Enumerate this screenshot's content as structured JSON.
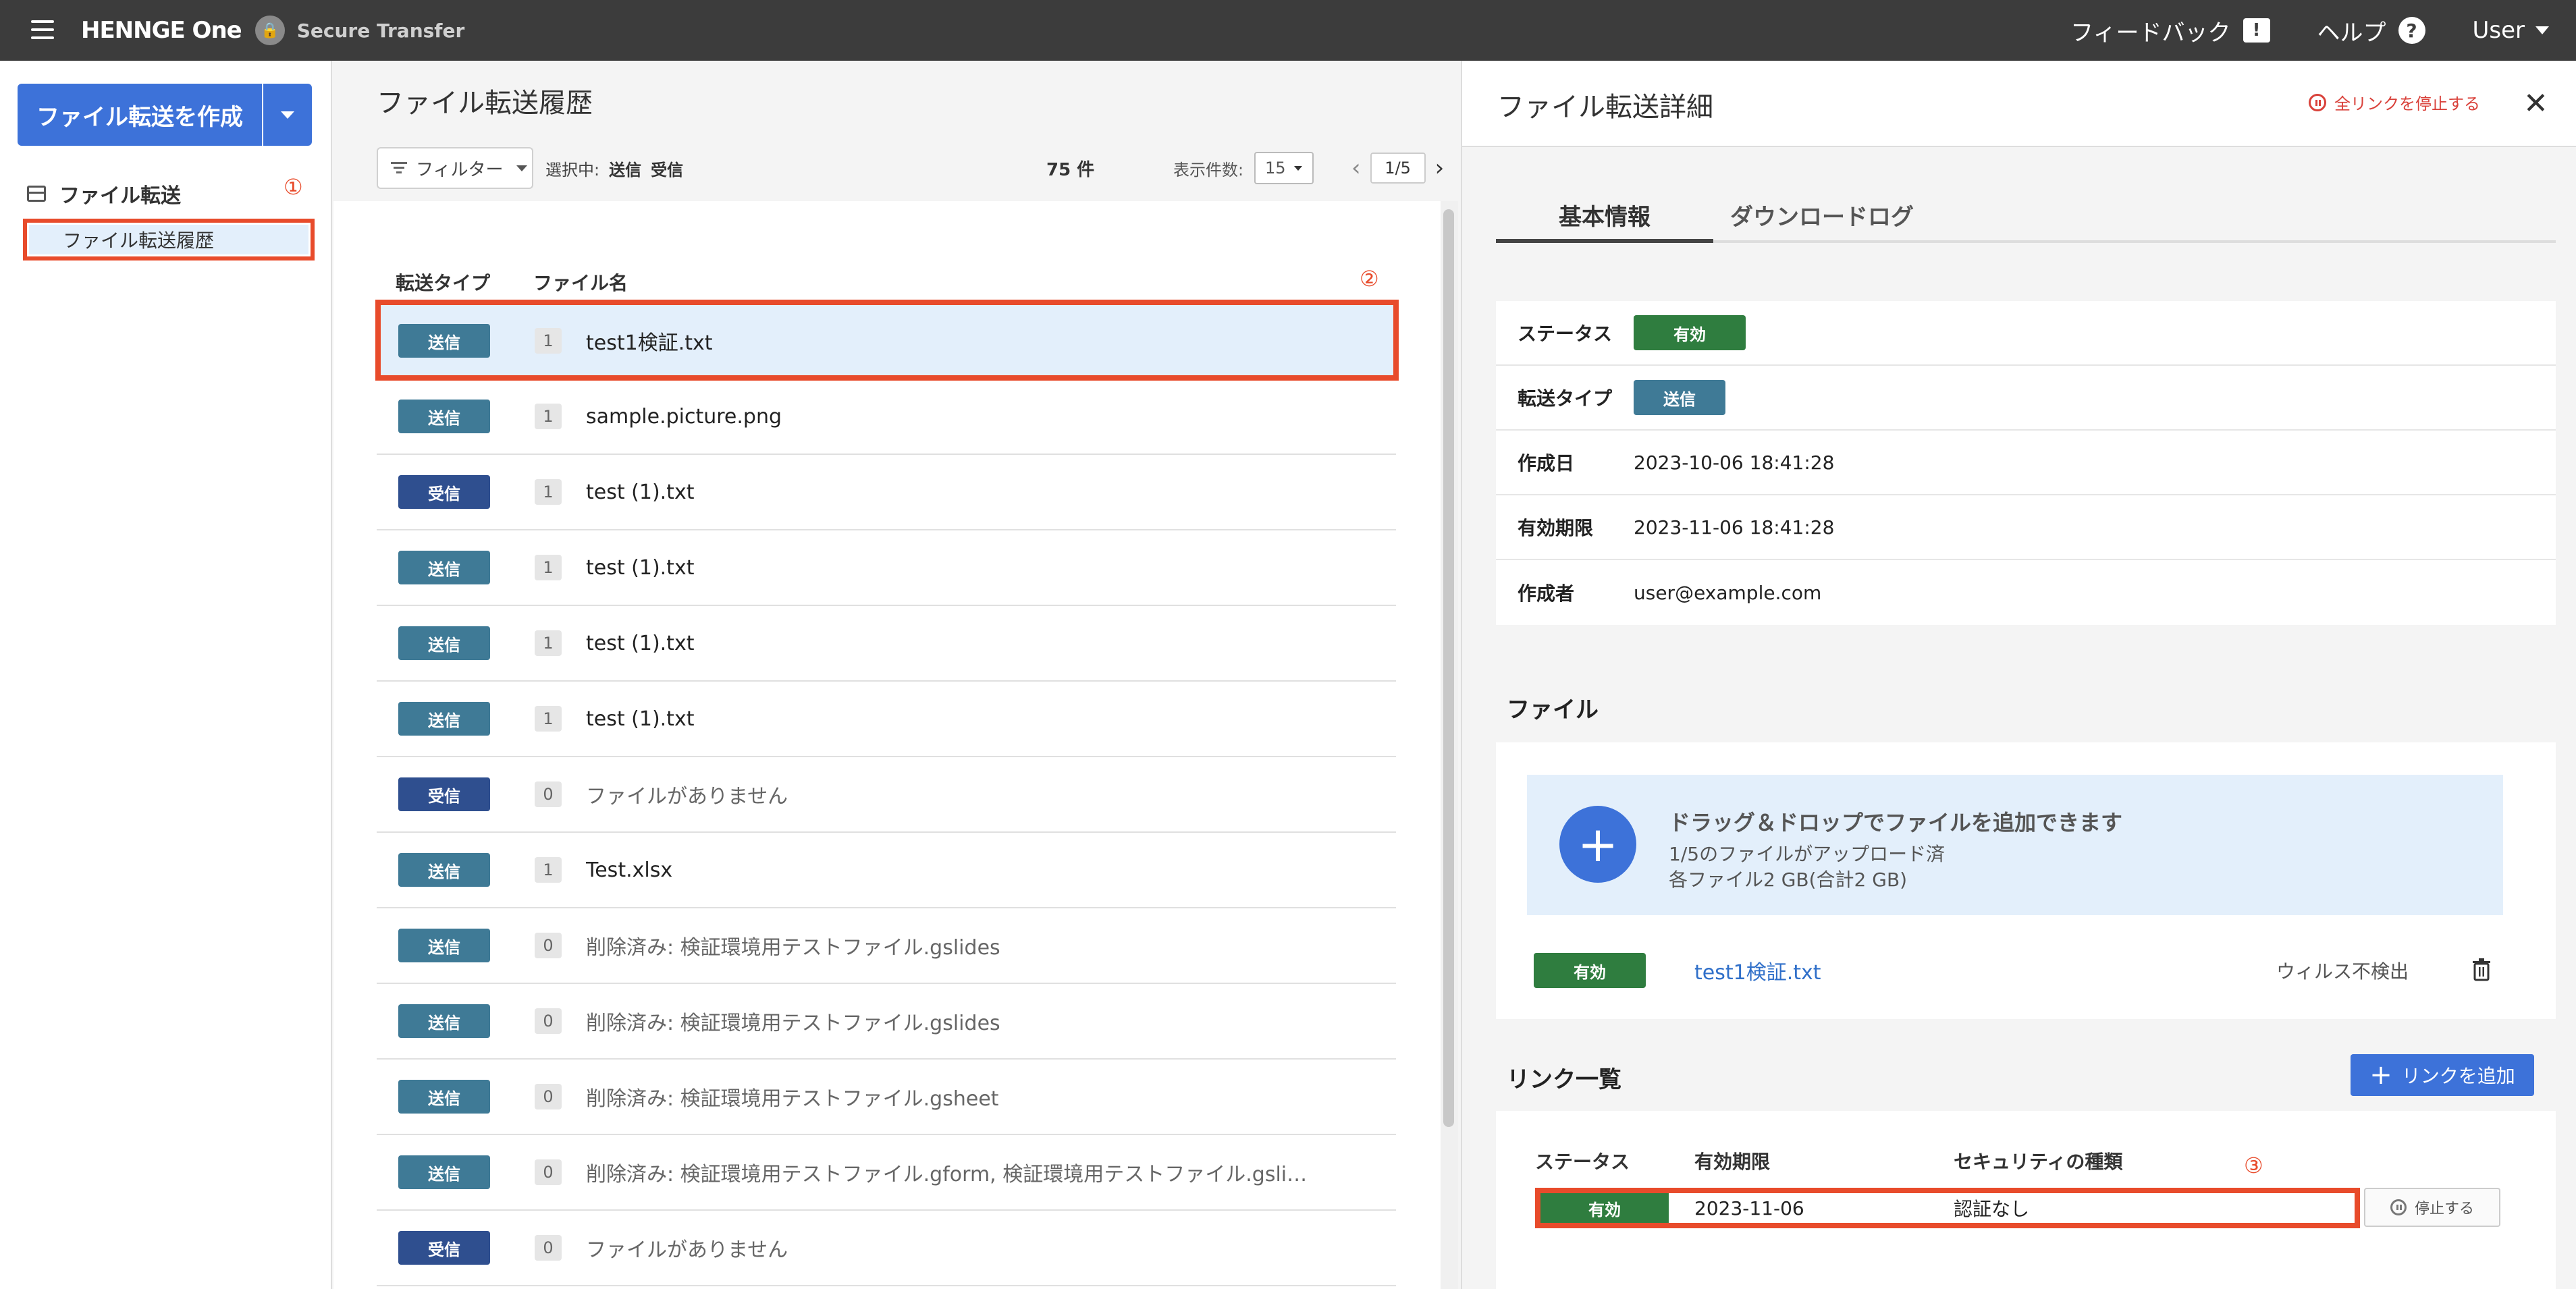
{
  "topbar": {
    "brand": "HENNGE One",
    "product": "Secure Transfer",
    "feedback": "フィードバック",
    "help": "ヘルプ",
    "user": "User"
  },
  "sidebar": {
    "create_label": "ファイル転送を作成",
    "section_label": "ファイル転送",
    "marker": "①",
    "item_history": "ファイル転送履歴"
  },
  "middle": {
    "title": "ファイル転送履歴",
    "filter_label": "フィルター",
    "selected_label": "選択中:",
    "selected_tags": [
      "送信",
      "受信"
    ],
    "count": "75 件",
    "per_page_label": "表示件数:",
    "per_page_value": "15",
    "page": "1/5",
    "col_type": "転送タイプ",
    "col_name": "ファイル名",
    "marker": "②",
    "rows": [
      {
        "type": "送信",
        "kind": "send",
        "count": "1",
        "name": "test1検証.txt",
        "muted": false
      },
      {
        "type": "送信",
        "kind": "send",
        "count": "1",
        "name": "sample.picture.png",
        "muted": false
      },
      {
        "type": "受信",
        "kind": "recv",
        "count": "1",
        "name": "test (1).txt",
        "muted": false
      },
      {
        "type": "送信",
        "kind": "send",
        "count": "1",
        "name": "test (1).txt",
        "muted": false
      },
      {
        "type": "送信",
        "kind": "send",
        "count": "1",
        "name": "test (1).txt",
        "muted": false
      },
      {
        "type": "送信",
        "kind": "send",
        "count": "1",
        "name": "test (1).txt",
        "muted": false
      },
      {
        "type": "受信",
        "kind": "recv",
        "count": "0",
        "name": "ファイルがありません",
        "muted": true
      },
      {
        "type": "送信",
        "kind": "send",
        "count": "1",
        "name": "Test.xlsx",
        "muted": false
      },
      {
        "type": "送信",
        "kind": "send",
        "count": "0",
        "name": "削除済み: 検証環境用テストファイル.gslides",
        "muted": true
      },
      {
        "type": "送信",
        "kind": "send",
        "count": "0",
        "name": "削除済み: 検証環境用テストファイル.gslides",
        "muted": true
      },
      {
        "type": "送信",
        "kind": "send",
        "count": "0",
        "name": "削除済み: 検証環境用テストファイル.gsheet",
        "muted": true
      },
      {
        "type": "送信",
        "kind": "send",
        "count": "0",
        "name": "削除済み: 検証環境用テストファイル.gform, 検証環境用テストファイル.gslides, 検...",
        "muted": true
      },
      {
        "type": "受信",
        "kind": "recv",
        "count": "0",
        "name": "ファイルがありません",
        "muted": true
      }
    ]
  },
  "detail": {
    "title": "ファイル転送詳細",
    "stop_all": "全リンクを停止する",
    "tab_basic": "基本情報",
    "tab_log": "ダウンロードログ",
    "info": {
      "status_key": "ステータス",
      "status_val": "有効",
      "type_key": "転送タイプ",
      "type_val": "送信",
      "created_key": "作成日",
      "created_val": "2023-10-06 18:41:28",
      "expiry_key": "有効期限",
      "expiry_val": "2023-11-06 18:41:28",
      "author_key": "作成者",
      "author_val": "user@example.com"
    },
    "files_title": "ファイル",
    "dropzone_title": "ドラッグ＆ドロップでファイルを追加できます",
    "dropzone_line1": "1/5のファイルがアップロード済",
    "dropzone_line2": "各ファイル2 GB(合計2 GB)",
    "file_status": "有効",
    "file_name": "test1検証.txt",
    "file_virus": "ウィルス不検出",
    "links_title": "リンク一覧",
    "add_link": "リンクを追加",
    "link_col_status": "ステータス",
    "link_col_expiry": "有効期限",
    "link_col_security": "セキュリティの種類",
    "marker": "③",
    "link_status": "有効",
    "link_expiry": "2023-11-06",
    "link_security": "認証なし",
    "link_stop": "停止する"
  },
  "colors": {
    "accent": "#3d72d9",
    "highlight": "#e84b2b",
    "send": "#3f7a96",
    "recv": "#2f4f8f",
    "active": "#2f7d3f"
  }
}
